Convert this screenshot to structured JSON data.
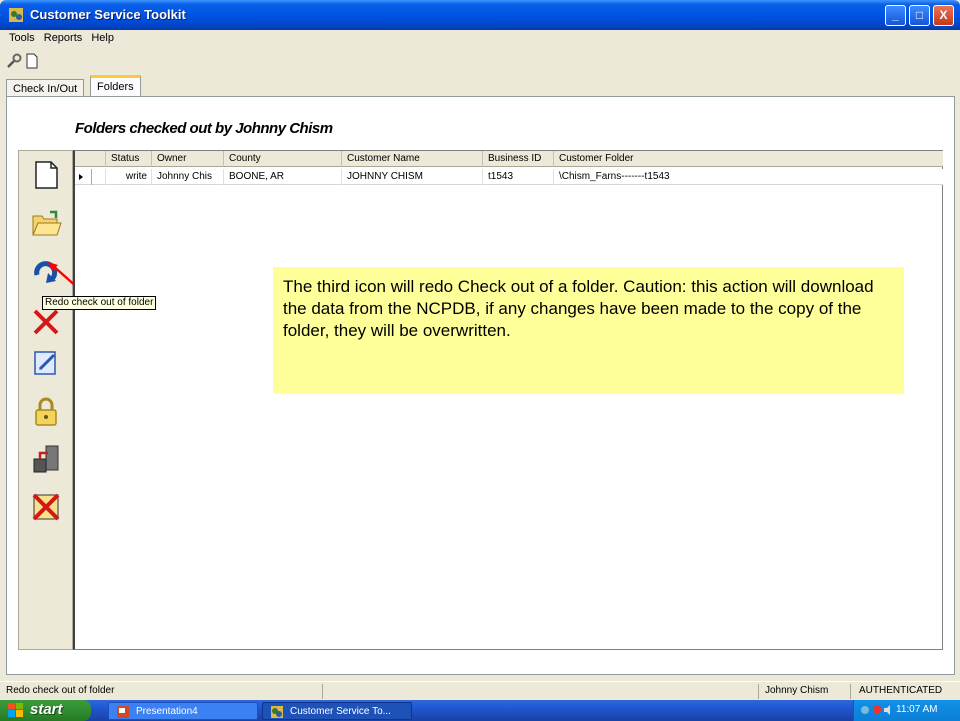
{
  "window": {
    "title": "Customer Service Toolkit",
    "controls": {
      "minimize": "_",
      "maximize": "□",
      "close": "X"
    }
  },
  "menu": [
    "Tools",
    "Reports",
    "Help"
  ],
  "toolbar": {
    "icons": [
      "tools-icon",
      "new-document-icon"
    ]
  },
  "tabs": [
    {
      "label": "Check In/Out",
      "active": false
    },
    {
      "label": "Folders",
      "active": true
    }
  ],
  "heading": "Folders checked out by Johnny Chism",
  "sidebar": {
    "buttons": [
      "new-document-icon",
      "open-folder-icon",
      "redo-checkout-icon",
      "delete-icon",
      "edit-document-icon",
      "lock-icon",
      "folder-transfer-icon",
      "cancel-icon"
    ]
  },
  "grid": {
    "columns": [
      "Status",
      "Owner",
      "County",
      "Customer Name",
      "Business ID",
      "Customer Folder"
    ],
    "rows": [
      [
        "write",
        "Johnny Chis",
        "BOONE, AR",
        "JOHNNY CHISM",
        "t1543",
        "\\Chism_Farns-------t1543"
      ]
    ]
  },
  "tooltip": "Redo check out of folder",
  "callout": "The third icon will redo Check out of a folder. Caution: this action will download the data from the NCPDB, if any changes have been made to the copy of the folder, they will be overwritten.",
  "statusbar": {
    "message": "Redo check out of folder",
    "user": "Johnny Chism",
    "auth": "AUTHENTICATED"
  },
  "taskbar": {
    "start": "start",
    "tasks": [
      "Presentation4",
      "Customer Service To..."
    ],
    "clock": "11:07 AM"
  },
  "colors": {
    "callout_bg": "#ffff99",
    "title_bar": "#0054e3",
    "arrow": "#ff0000"
  }
}
